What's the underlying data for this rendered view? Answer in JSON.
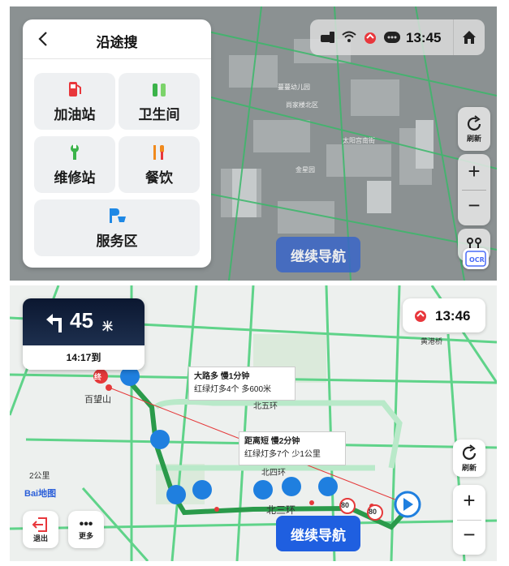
{
  "top_panel": {
    "card": {
      "title": "沿途搜",
      "categories": [
        {
          "label": "加油站",
          "icon": "gas-station-icon",
          "color": "#e8373c"
        },
        {
          "label": "卫生间",
          "icon": "toilet-icon",
          "color": "#3bb34a"
        },
        {
          "label": "维修站",
          "icon": "wrench-icon",
          "color": "#3bb34a"
        },
        {
          "label": "餐饮",
          "icon": "fork-knife-icon",
          "color": "#f08a1d"
        },
        {
          "label": "服务区",
          "icon": "service-area-icon",
          "color": "#1e88e5"
        }
      ]
    },
    "status": {
      "time": "13:45"
    },
    "map_labels": [
      "蔓蔓幼儿园",
      "尚家楼北区",
      "太阳宫南街",
      "金星园"
    ],
    "right_controls": {
      "refresh_label": "刷新"
    },
    "continue_label": "继续导航"
  },
  "bottom_panel": {
    "turn": {
      "distance": "45",
      "unit": "米",
      "eta": "14:17到"
    },
    "status": {
      "time": "13:46"
    },
    "map_labels": {
      "end": "终",
      "baiwangshan": "百望山",
      "north5": "北五环",
      "north4": "北四环",
      "north3": "北三环",
      "scale": "2公里",
      "bridge": "黄港桥",
      "logo": "Bai地图",
      "speed1": "80",
      "speed2": "80"
    },
    "route_boxes": [
      {
        "title": "大路多  慢1分钟",
        "detail": "红绿灯多4个  多600米"
      },
      {
        "title": "距离短  慢2分钟",
        "detail": "红绿灯多7个  少1公里"
      }
    ],
    "controls": {
      "refresh_label": "刷新",
      "exit_label": "退出",
      "more_label": "更多"
    },
    "continue_label": "继续导航"
  },
  "colors": {
    "accent": "#1f5fe0",
    "road_green": "#3ec46d",
    "dark_card": "#0f1d33"
  }
}
